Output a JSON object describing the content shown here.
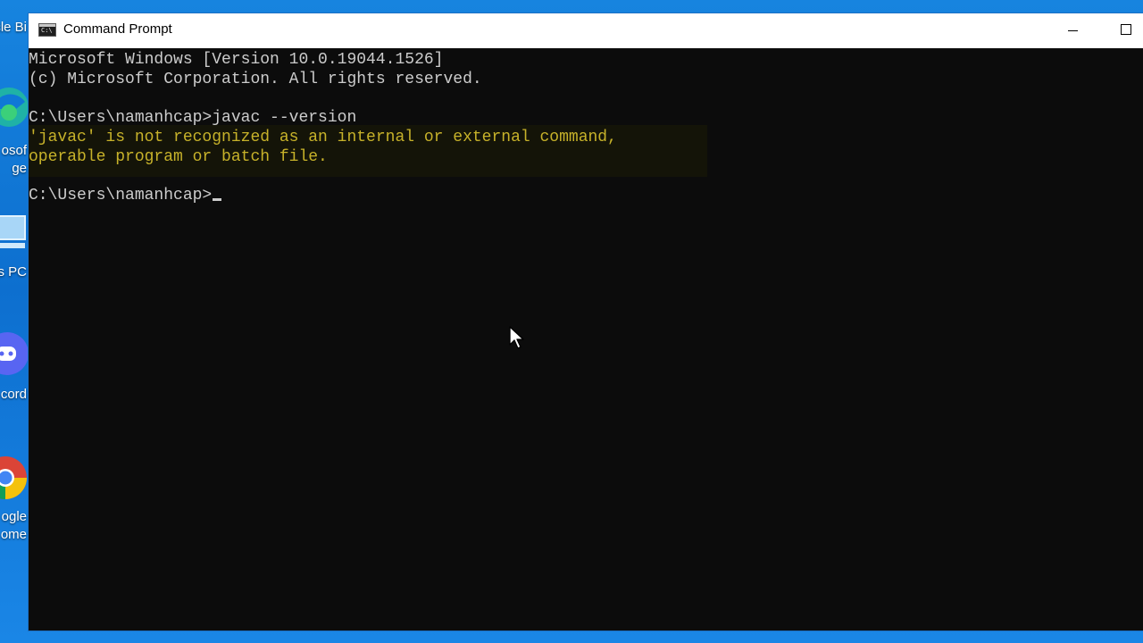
{
  "desktop": {
    "labels": [
      "cle Bi",
      "osof",
      "ge",
      "s PC",
      "cord",
      "ogle",
      "ome"
    ]
  },
  "window": {
    "title": "Command Prompt",
    "icon": "cmd-icon",
    "icon_glyph": "C:\\",
    "minimize_icon": "minimize-icon",
    "maximize_icon": "maximize-icon"
  },
  "console": {
    "lines": [
      "Microsoft Windows [Version 10.0.19044.1526]",
      "(c) Microsoft Corporation. All rights reserved.",
      "",
      "C:\\Users\\namanhcap>javac --version",
      "'javac' is not recognized as an internal or external command,",
      "operable program or batch file.",
      "",
      "C:\\Users\\namanhcap>"
    ],
    "error_color": "#c7b22a",
    "text_color": "#cccccc",
    "background": "#0c0c0c"
  },
  "colors": {
    "desktop_blue": "#1784df",
    "titlebar": "#ffffff"
  }
}
